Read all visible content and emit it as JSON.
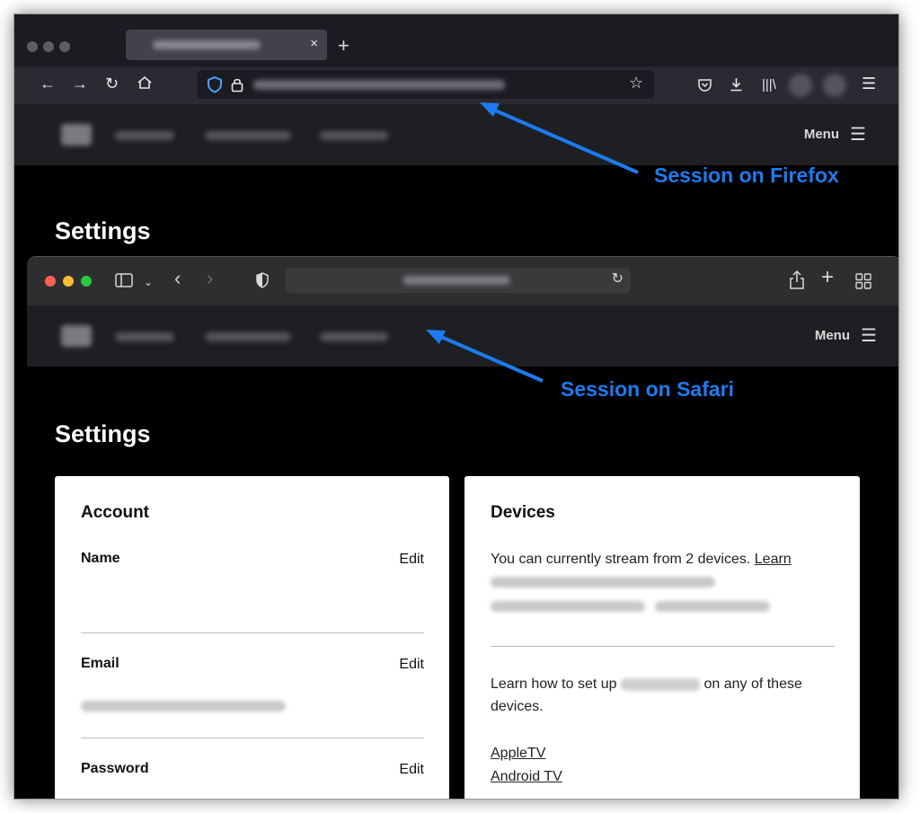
{
  "firefox": {
    "tab_close": "×",
    "new_tab": "+",
    "site": {
      "menu_label": "Menu"
    },
    "settings_title": "Settings"
  },
  "safari": {
    "site": {
      "menu_label": "Menu"
    },
    "settings_title": "Settings"
  },
  "account_card": {
    "title": "Account",
    "fields": [
      {
        "label": "Name",
        "edit": "Edit"
      },
      {
        "label": "Email",
        "edit": "Edit"
      },
      {
        "label": "Password",
        "edit": "Edit"
      }
    ]
  },
  "devices_card": {
    "title": "Devices",
    "stream_text": "You can currently stream from 2 devices. ",
    "stream_link": "Learn",
    "setup_prefix": "Learn how to set up",
    "setup_suffix": "on any of these devices.",
    "device_links": [
      "AppleTV",
      "Android TV"
    ]
  },
  "annotations": {
    "firefox": "Session on Firefox",
    "safari": "Session on Safari",
    "color": "#1d7bf0"
  },
  "icons": {
    "firefox_nav": [
      "back-icon",
      "forward-icon",
      "reload-icon",
      "home-icon",
      "shield-icon",
      "lock-icon",
      "star-icon",
      "pocket-icon",
      "download-icon",
      "library-icon",
      "hamburger-icon"
    ],
    "safari_nav": [
      "sidebar-icon",
      "chevron-down-icon",
      "back-icon",
      "forward-icon",
      "privacy-shield-icon",
      "reload-icon",
      "share-icon",
      "new-tab-icon",
      "tab-overview-icon"
    ]
  }
}
